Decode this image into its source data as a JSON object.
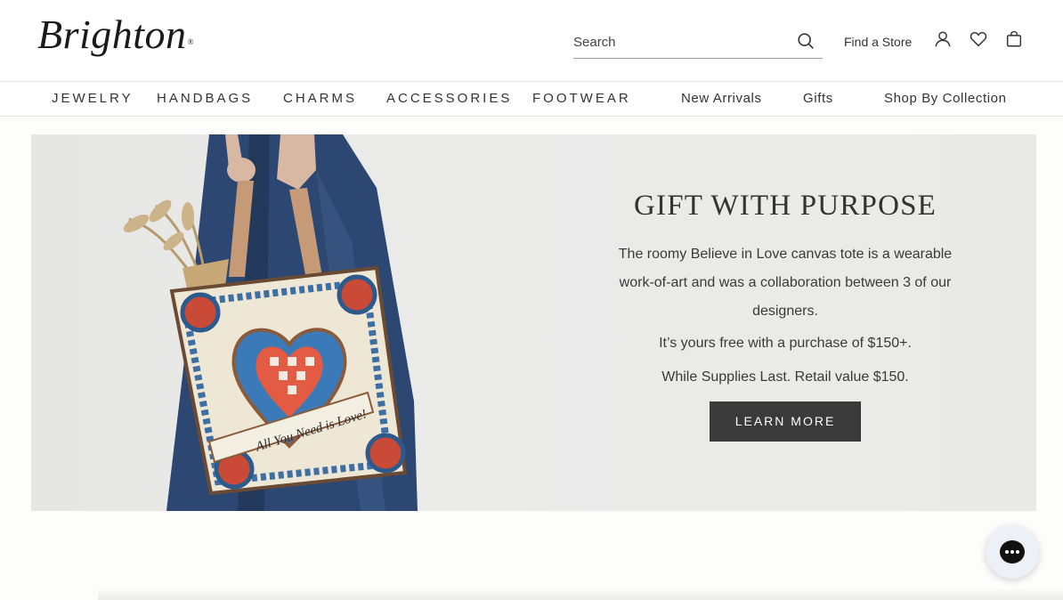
{
  "header": {
    "logo": "Brighton",
    "logo_mark": "®",
    "search_placeholder": "Search",
    "find_store": "Find a Store",
    "icons": [
      "search-icon",
      "account-icon",
      "wishlist-icon",
      "shopping-bag-icon"
    ]
  },
  "nav": {
    "categories": [
      "JEWELRY",
      "HANDBAGS",
      "CHARMS",
      "ACCESSORIES",
      "FOOTWEAR"
    ],
    "secondary": [
      "New Arrivals",
      "Gifts",
      "Shop By Collection"
    ]
  },
  "hero": {
    "title": "GIFT WITH PURPOSE",
    "body": "The roomy Believe in Love canvas tote is a wearable work-of-art and was a collaboration between 3 of our designers.",
    "offer": "It’s yours free with a purchase of $150+.",
    "supply": "While Supplies Last. Retail value $150.",
    "cta": "LEARN MORE",
    "image_text": "All You Need is Love!"
  },
  "chat": {
    "icon": "chat-icon"
  },
  "colors": {
    "cta_bg": "#3a3a3a",
    "hero_bg": "#e9e9e8",
    "text": "#333333"
  }
}
